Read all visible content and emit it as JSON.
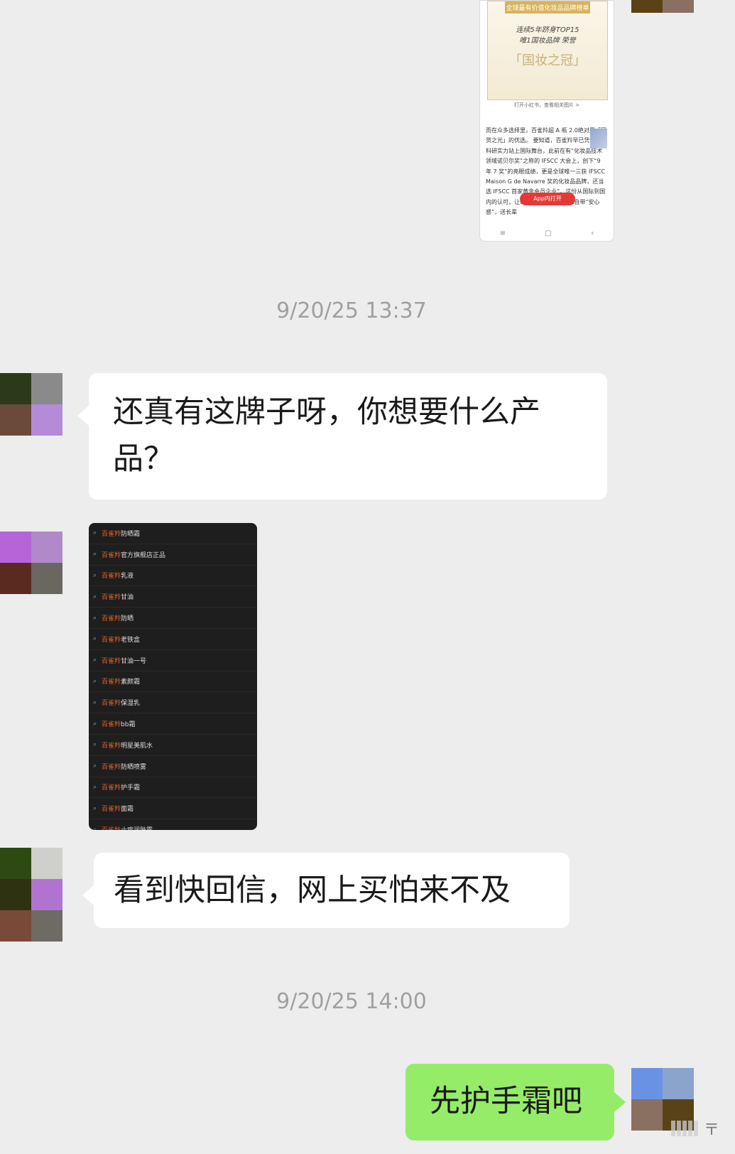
{
  "colors": {
    "background": "#ededed",
    "bubble_received": "#ffffff",
    "bubble_sent": "#95ec69",
    "timestamp": "#a0a0a0",
    "brand_orange": "#e8642c"
  },
  "shared_article": {
    "poster_banner": "全球最有价值化妆品品牌榜单",
    "poster_line_1": "连续5年跻身TOP15",
    "poster_line_2": "唯1国妆品牌 荣誉",
    "poster_title": "「国妆之冠」",
    "poster_caption": "打开小红书，查看相关图片 >",
    "article_text": "而在众多选择里，百雀羚超 A 瓶 2.0绝对是「国货之光」的优选。 要知道，百雀羚早已凭借硬核科研实力站上国际舞台，此前在有“化妆品技术领域诺贝尔奖”之称的 IFSCC 大会上，创下“9 年 7 奖”的亮眼成绩，更是全球唯一三获 IFSCC Maison G de Navarre 奖的化妆品品牌，还当选 IFSCC 首家黄金会员企业”。这份从国际到国内的认可，让每一瓶超 A 瓶 2.0 都自带“安心感”，送长辈",
    "open_app_button": "App内打开",
    "nav_menu_icon": "≡",
    "nav_home_icon": "▢",
    "nav_back_icon": "‹"
  },
  "messages": [
    {
      "type": "timestamp",
      "text": "9/20/25 13:37"
    },
    {
      "type": "received",
      "text": "还真有这牌子呀，你想要什么产品？"
    },
    {
      "type": "received-image",
      "description_icon": "search-suggestions-image"
    },
    {
      "type": "received",
      "text": "看到快回信，网上买怕来不及"
    },
    {
      "type": "timestamp",
      "text": "9/20/25 14:00"
    },
    {
      "type": "sent",
      "text": "先护手霜吧"
    }
  ],
  "search_suggestions": {
    "brand": "百雀羚",
    "terms": [
      "防晒霜",
      "官方旗舰店正品",
      "乳液",
      "甘油",
      "防晒",
      "老铁盒",
      "甘油一号",
      "素颜霜",
      "保湿乳",
      "bb霜",
      "明星美肌水",
      "防晒喷雾",
      "护手霜",
      "面霜",
      "止痒润肤露"
    ]
  },
  "avatars": {
    "top_right": [
      "#5a4214",
      "#8a7064"
    ],
    "contact_1": [
      "#2c3a1a",
      "#8a8a8a",
      "#6b4a3a",
      "#b58ad8"
    ],
    "contact_2": [
      "#b565d8",
      "#b08ac8",
      "#5a2a20",
      "#6a6660"
    ],
    "contact_3": [
      "#2e4a12",
      "#cfcfcb",
      "#2e3212",
      "#b074d0",
      "#7a4a38",
      "#6e6a64"
    ],
    "self": [
      "#6a92e4",
      "#8aa4cc",
      "#8a7060",
      "#5a4218"
    ]
  },
  "watermark": {
    "text": "〒"
  }
}
